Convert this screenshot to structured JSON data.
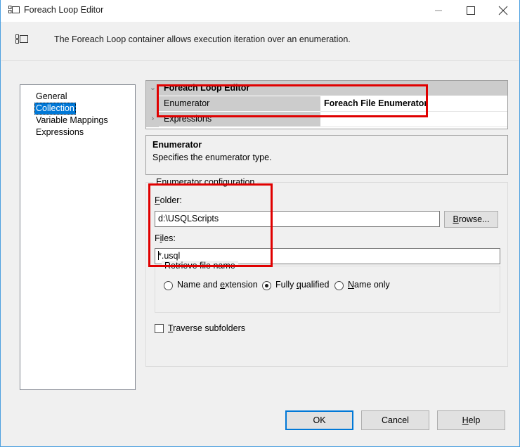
{
  "window": {
    "title": "Foreach Loop Editor",
    "icon": "foreach-loop-icon",
    "minimize_label": "Minimize",
    "maximize_label": "Maximize",
    "close_label": "Close"
  },
  "banner": {
    "icon": "foreach-loop-icon",
    "text": "The Foreach Loop container allows execution iteration over an enumeration."
  },
  "sidebar": {
    "items": [
      {
        "label": "General",
        "selected": false
      },
      {
        "label": "Collection",
        "selected": true
      },
      {
        "label": "Variable Mappings",
        "selected": false
      },
      {
        "label": "Expressions",
        "selected": false
      }
    ]
  },
  "property_grid": {
    "rows": [
      {
        "chevron": "⌄",
        "name": "Foreach Loop Editor",
        "value": "",
        "kind": "category"
      },
      {
        "chevron": "",
        "name": "Enumerator",
        "value": "Foreach File Enumerator",
        "kind": "property-bold"
      },
      {
        "chevron": "›",
        "name": "Expressions",
        "value": "",
        "kind": "property"
      }
    ]
  },
  "description": {
    "title": "Enumerator",
    "body": "Specifies the enumerator type."
  },
  "enumerator_configuration": {
    "group_title": "Enumerator configuration",
    "folder_label": "Folder:",
    "folder_value": "d:\\USQLScripts",
    "files_label": "Files:",
    "files_value": "*.usql",
    "browse_label": "Browse...",
    "retrieve": {
      "group_title": "Retrieve file name",
      "options": [
        {
          "label": "Name and extension",
          "checked": false
        },
        {
          "label": "Fully qualified",
          "checked": true
        },
        {
          "label": "Name only",
          "checked": false
        }
      ]
    },
    "traverse_subfolders": {
      "label": "Traverse subfolders",
      "checked": false
    }
  },
  "footer": {
    "ok_label": "OK",
    "cancel_label": "Cancel",
    "help_label": "Help"
  },
  "annotations": {
    "accent_color": "#e00000",
    "rect_1_target": "enumerator-property-row",
    "rect_2_target": "enumerator-configuration-fields"
  }
}
